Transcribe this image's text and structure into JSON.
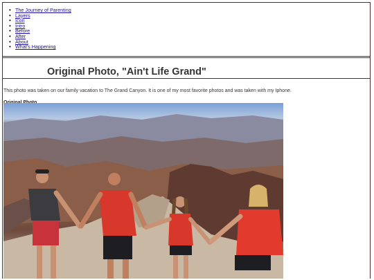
{
  "nav": {
    "items": [
      {
        "label": "The Journey of Parenting"
      },
      {
        "label": "Layers"
      },
      {
        "label": "Icon"
      },
      {
        "label": "Intro"
      },
      {
        "label": "Before"
      },
      {
        "label": "After"
      },
      {
        "label": "About"
      },
      {
        "label": "What's Happening"
      }
    ]
  },
  "page": {
    "title": "Original Photo, \"Ain't Life Grand\"",
    "intro": "This photo was taken on our family vacation to The Grand Canyon. It is one of my most favorite photos and was taken with my Iphone.",
    "label_bold": "Original Photo",
    "label_tail": "."
  },
  "colors": {
    "link": "#1a0dab",
    "border": "#5a2a2a",
    "shirt_red": "#d8382c"
  }
}
